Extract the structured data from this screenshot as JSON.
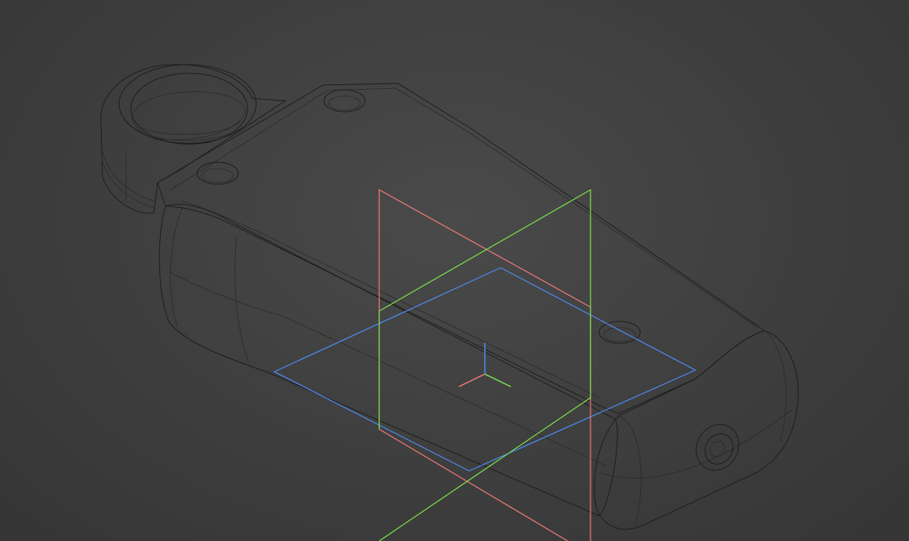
{
  "viewport": {
    "background_color": "#3f3f3f",
    "model_color": "#8a8a8a",
    "edge_color": "#1e1e1e"
  },
  "origin_planes": {
    "xy_plane_color": "#4a8df0",
    "xz_plane_color": "#f07a7a",
    "yz_plane_color": "#7ae64a"
  },
  "axis_triad": {
    "x_axis_color": "#f07a7a",
    "y_axis_color": "#7ae64a",
    "z_axis_color": "#4a8df0"
  }
}
